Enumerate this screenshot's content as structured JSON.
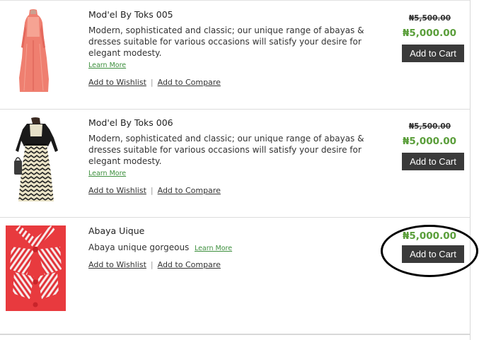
{
  "products": [
    {
      "name": "Mod'el By Toks 005",
      "description": "Modern, sophisticated and classic; our unique range of abayas & dresses suitable for various occasions will satisfy your desire for elegant modesty.",
      "learn_more": "Learn More",
      "wishlist": "Add to Wishlist",
      "compare": "Add to Compare",
      "separator": "|",
      "old_price": "₦5,500.00",
      "price": "₦5,000.00",
      "add_to_cart": "Add to Cart",
      "image": "coral-dress-image"
    },
    {
      "name": "Mod'el By Toks 006",
      "description": "Modern, sophisticated and classic; our unique range of abayas & dresses suitable for various occasions will satisfy your desire for elegant modesty.",
      "learn_more": "Learn More",
      "wishlist": "Add to Wishlist",
      "compare": "Add to Compare",
      "separator": "|",
      "old_price": "₦5,500.00",
      "price": "₦5,000.00",
      "add_to_cart": "Add to Cart",
      "image": "black-cream-chevron-dress-image"
    },
    {
      "name": "Abaya Uique",
      "description": "Abaya unique gorgeous",
      "learn_more": "Learn More",
      "wishlist": "Add to Wishlist",
      "compare": "Add to Compare",
      "separator": "|",
      "price": "₦5,000.00",
      "add_to_cart": "Add to Cart",
      "image": "red-striped-blouse-image"
    }
  ],
  "colors": {
    "price_green": "#5a9e3a",
    "button_dark": "#3a3a3a",
    "link_green": "#3d8f3d",
    "annotation": "#000000"
  }
}
